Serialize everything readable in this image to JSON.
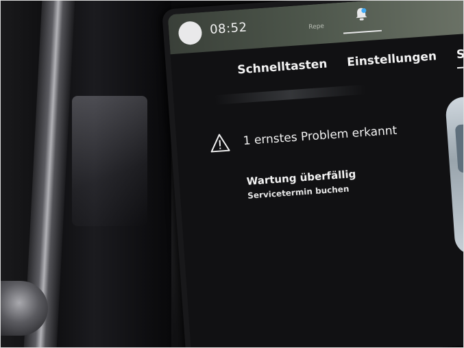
{
  "status_bar": {
    "time": "08:52",
    "map_label": "Repe"
  },
  "tabs": [
    {
      "label": "Schnelltasten",
      "active": false
    },
    {
      "label": "Einstellungen",
      "active": false
    },
    {
      "label": "Statu",
      "active": true
    }
  ],
  "alert": {
    "icon": "warning-triangle-icon",
    "title": "1 ernstes Problem erkannt"
  },
  "service": {
    "title": "Wartung überfällig",
    "action": "Servicetermin buchen"
  },
  "colors": {
    "screen_bg": "#111113",
    "text": "#f2f2f2",
    "notification_dot": "#3fa9f5"
  }
}
